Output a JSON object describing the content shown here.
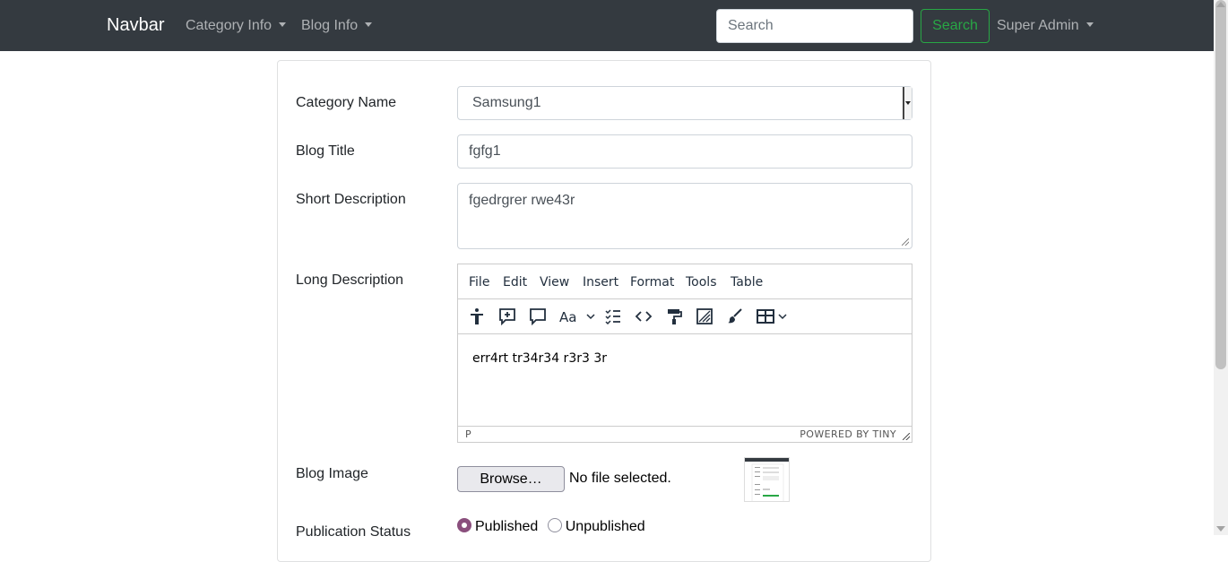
{
  "navbar": {
    "brand": "Navbar",
    "menus": [
      {
        "label": "Category Info"
      },
      {
        "label": "Blog Info"
      }
    ],
    "search_placeholder": "Search",
    "search_button": "Search",
    "user_menu": "Super Admin",
    "background": "#343a40"
  },
  "form": {
    "category_label": "Category Name",
    "category_value": "Samsung1",
    "title_label": "Blog Title",
    "title_value": "fgfg1",
    "short_label": "Short Description",
    "short_value": "fgedrgrer rwe43r",
    "long_label": "Long Description",
    "editor": {
      "menu": [
        "File",
        "Edit",
        "View",
        "Insert",
        "Format",
        "Tools",
        "Table"
      ],
      "toolbar_icons": [
        "accessibility-icon",
        "add-comment-icon",
        "comment-icon",
        "text-case-icon",
        "checklist-icon",
        "code-icon",
        "format-painter-icon",
        "clear-format-icon",
        "brush-icon",
        "table-icon"
      ],
      "content": "err4rt tr34r34 r3r3 3r",
      "status_path": "P",
      "branding": "POWERED BY TINY"
    },
    "image_label": "Blog Image",
    "browse_button": "Browse…",
    "file_status": "No file selected.",
    "publication_label": "Publication Status",
    "publication_options": [
      {
        "label": "Published",
        "checked": true
      },
      {
        "label": "Unpublished",
        "checked": false
      }
    ]
  },
  "colors": {
    "success": "#28a745",
    "radio_accent": "#8a4f7d"
  }
}
